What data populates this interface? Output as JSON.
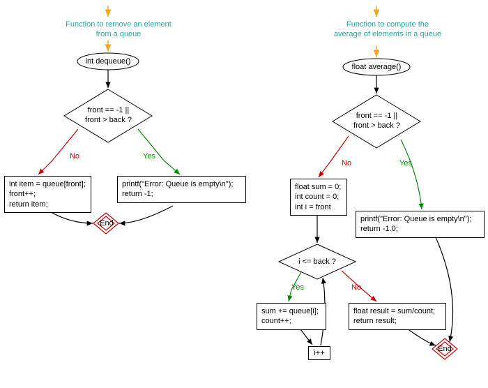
{
  "left": {
    "title": "Function to remove an element from a queue",
    "start": "int dequeue()",
    "decision": "front == -1 ||\nfront > back ?",
    "no_label": "No",
    "yes_label": "Yes",
    "no_box": "int item = queue[front];\nfront++;\nreturn item;",
    "yes_box": "printf(\"Error: Queue is empty\\n\");\nreturn -1;",
    "end": "End"
  },
  "right": {
    "title": "Function to compute the average of elements in a queue",
    "start": "float average()",
    "decision": "front == -1 ||\nfront > back ?",
    "no_label": "No",
    "yes_label": "Yes",
    "no_box": "float sum = 0;\nint count = 0;\nint i = front",
    "yes_box": "printf(\"Error: Queue is empty\\n\");\nreturn -1.0;",
    "loop_decision": "i <= back ?",
    "loop_yes": "Yes",
    "loop_no": "No",
    "loop_body": "sum += queue[i];\ncount++;",
    "increment": "i++",
    "result_box": "float result = sum/count;\nreturn result;",
    "end": "End"
  }
}
